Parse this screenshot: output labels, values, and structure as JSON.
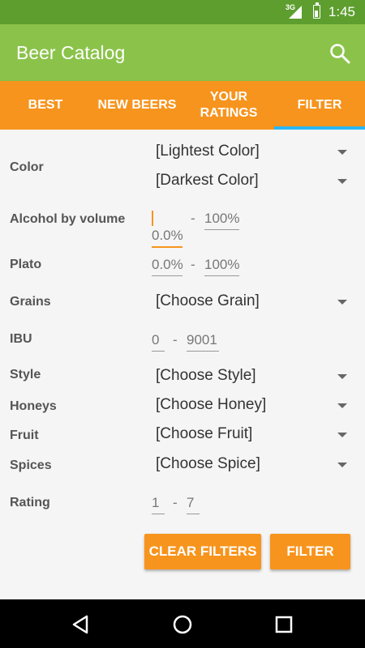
{
  "status_bar": {
    "network": "3G",
    "time": "1:45"
  },
  "app_bar": {
    "title": "Beer Catalog",
    "search_icon": "search-icon"
  },
  "tabs": [
    {
      "label": "BEST",
      "active": false
    },
    {
      "label": "NEW BEERS",
      "active": false
    },
    {
      "label": "YOUR\nRATINGS",
      "active": false
    },
    {
      "label": "FILTER",
      "active": true
    }
  ],
  "filter": {
    "color": {
      "label": "Color",
      "lightest": "[Lightest Color]",
      "darkest": "[Darkest Color]"
    },
    "abv": {
      "label": "Alcohol by volume",
      "min": "0.0%",
      "sep": "-",
      "max": "100%"
    },
    "plato": {
      "label": "Plato",
      "min": "0.0%",
      "sep": "-",
      "max": "100%"
    },
    "grains": {
      "label": "Grains",
      "value": "[Choose Grain]"
    },
    "ibu": {
      "label": "IBU",
      "min": "0",
      "sep": "-",
      "max": "9001"
    },
    "style": {
      "label": "Style",
      "value": "[Choose Style]"
    },
    "honeys": {
      "label": "Honeys",
      "value": "[Choose Honey]"
    },
    "fruit": {
      "label": "Fruit",
      "value": "[Choose Fruit]"
    },
    "spices": {
      "label": "Spices",
      "value": "[Choose Spice]"
    },
    "rating": {
      "label": "Rating",
      "min": "1",
      "sep": "-",
      "max": "7"
    }
  },
  "buttons": {
    "clear": "CLEAR FILTERS",
    "filter": "FILTER"
  },
  "colors": {
    "status_bar": "#5d9e2f",
    "app_bar": "#8bc34a",
    "accent": "#f7941d",
    "tab_indicator": "#29b6f6"
  }
}
